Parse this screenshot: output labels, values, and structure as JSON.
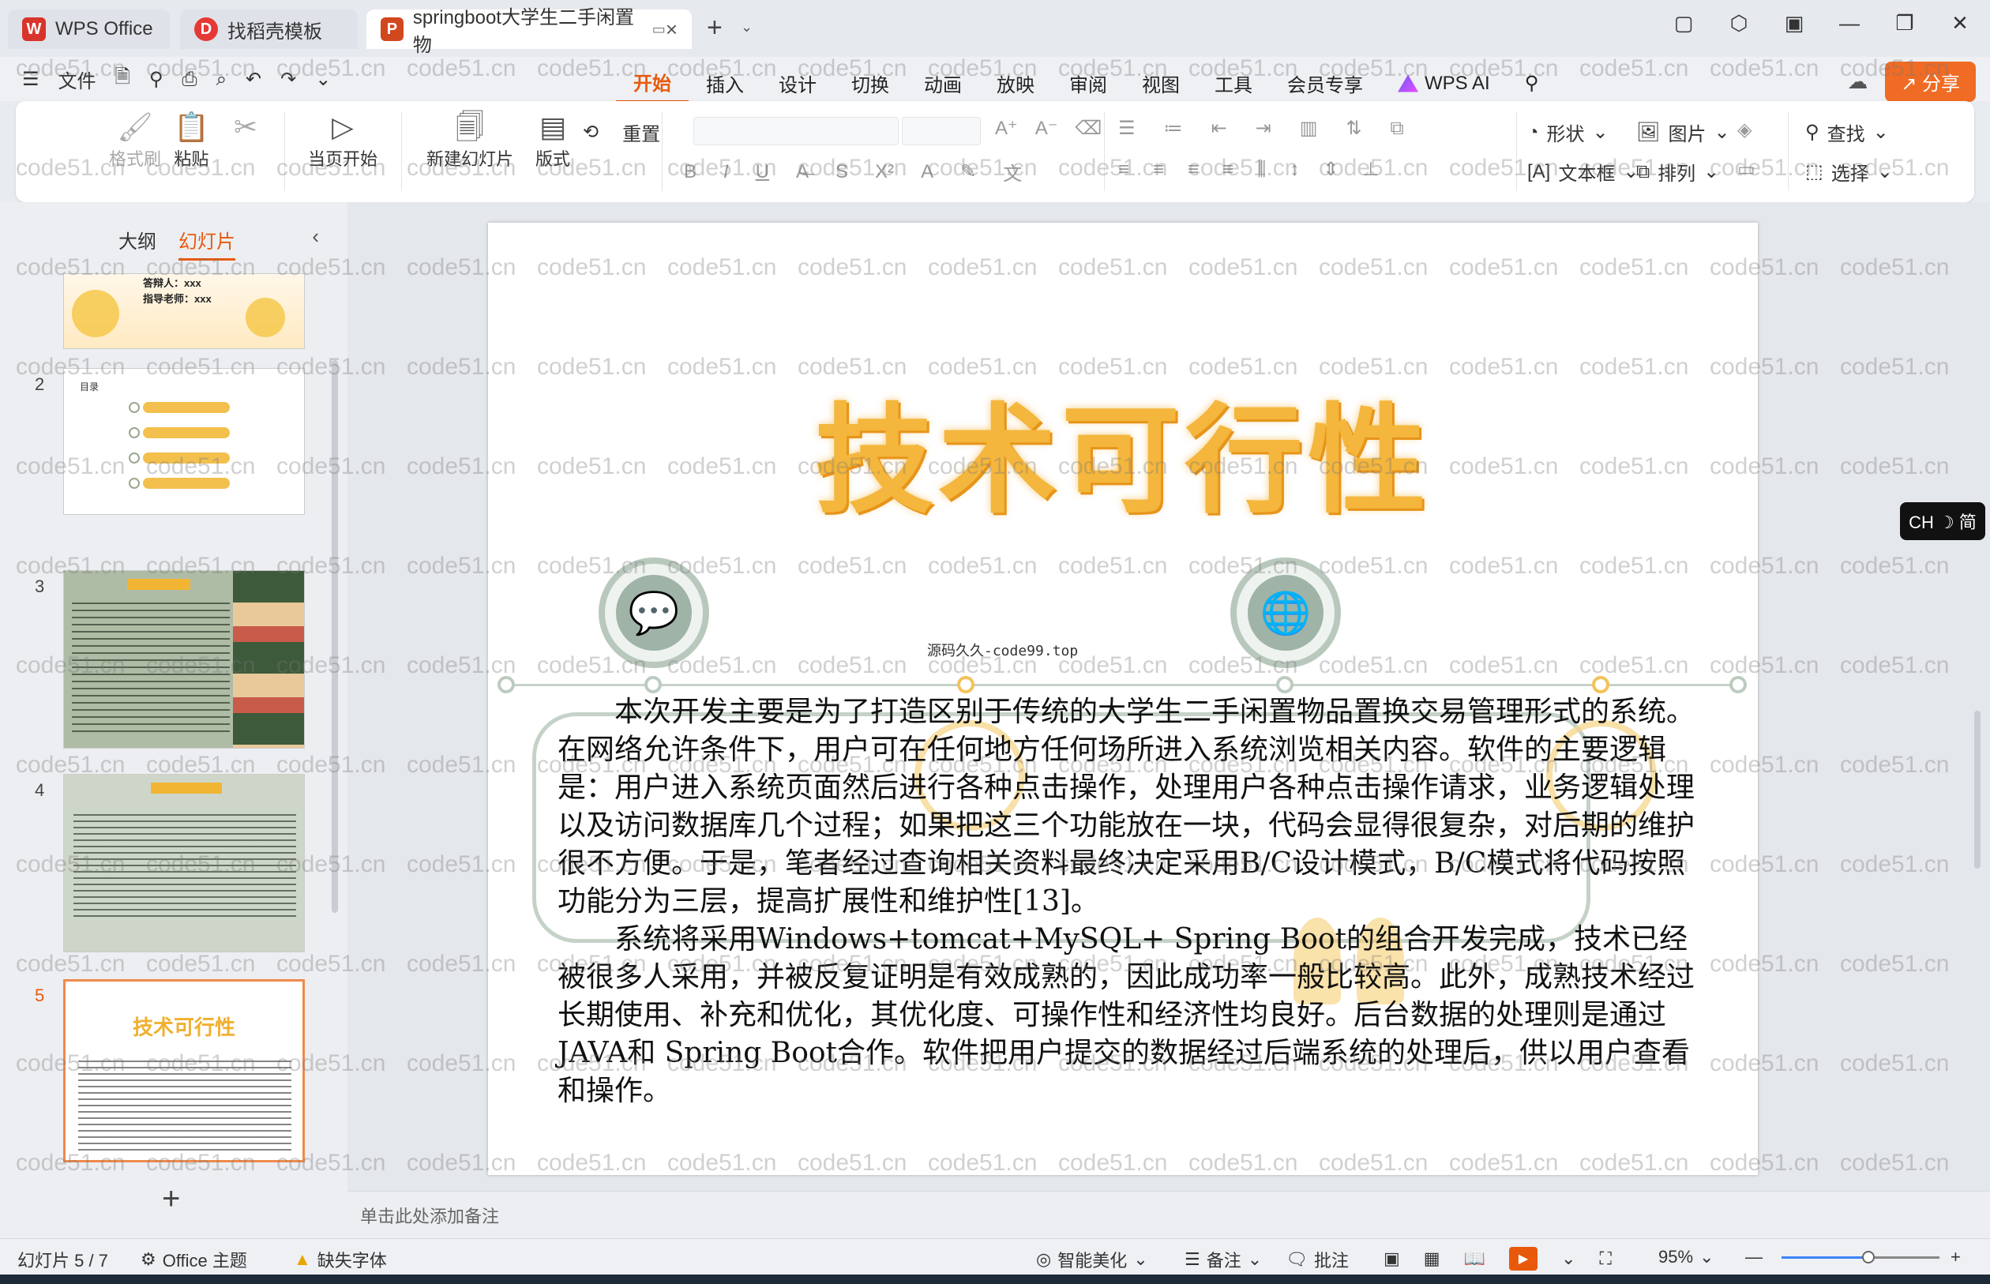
{
  "tabs": [
    {
      "label": "WPS Office",
      "logo": "W",
      "color": "#d9342b"
    },
    {
      "label": "找稻壳模板",
      "logo": "D",
      "color": "#e53935"
    },
    {
      "label": "springboot大学生二手闲置物",
      "logo": "P",
      "color": "#d2481e"
    }
  ],
  "menu": {
    "file": "文件",
    "tabs": [
      "开始",
      "插入",
      "设计",
      "切换",
      "动画",
      "放映",
      "审阅",
      "视图",
      "工具",
      "会员专享"
    ],
    "active_tab": "开始",
    "ai": "WPS AI",
    "share": "分享"
  },
  "ribbon": {
    "format_painter": "格式刷",
    "paste": "粘贴",
    "start_from_current": "当页开始",
    "new_slide": "新建幻灯片",
    "layout": "版式",
    "reset": "重置",
    "shape": "形状",
    "picture": "图片",
    "find": "查找",
    "textbox": "文本框",
    "arrange": "排列",
    "select": "选择"
  },
  "left_panel": {
    "tab_outline": "大纲",
    "tab_slides": "幻灯片",
    "thumb1_line1": "答辩人：xxx",
    "thumb1_line2": "指导老师：xxx",
    "thumb2_label": "目录",
    "thumb5_title": "技术可行性",
    "slide_numbers": [
      "2",
      "3",
      "4",
      "5"
    ]
  },
  "slide": {
    "title": "技术可行性",
    "source_mark": "源码久久-code99.top",
    "paragraph1": "本次开发主要是为了打造区别于传统的大学生二手闲置物品置换交易管理形式的系统。在网络允许条件下，用户可在任何地方任何场所进入系统浏览相关内容。软件的主要逻辑是：用户进入系统页面然后进行各种点击操作，处理用户各种点击操作请求，业务逻辑处理以及访问数据库几个过程；如果把这三个功能放在一块，代码会显得很复杂，对后期的维护很不方便。于是，笔者经过查询相关资料最终决定采用B/C设计模式，B/C模式将代码按照功能分为三层，提高扩展性和维护性[13]。",
    "paragraph2": "系统将采用Windows+tomcat+MySQL+ Spring Boot的组合开发完成，技术已经被很多人采用，并被反复证明是有效成熟的，因此成功率一般比较高。此外，成熟技术经过长期使用、补充和优化，其优化度、可操作性和经济性均良好。后台数据的处理则是通过JAVA和 Spring Boot合作。软件把用户提交的数据经过后端系统的处理后，供以用户查看和操作。"
  },
  "notes_placeholder": "单击此处添加备注",
  "ime": "CH ☽ 简",
  "watermark": "code51.cn",
  "status": {
    "slide_counter": "幻灯片 5 / 7",
    "theme": "Office 主题",
    "missing_font": "缺失字体",
    "beautify": "智能美化",
    "notes": "备注",
    "comments": "批注",
    "zoom": "95%",
    "zoom_level": 0.55
  }
}
